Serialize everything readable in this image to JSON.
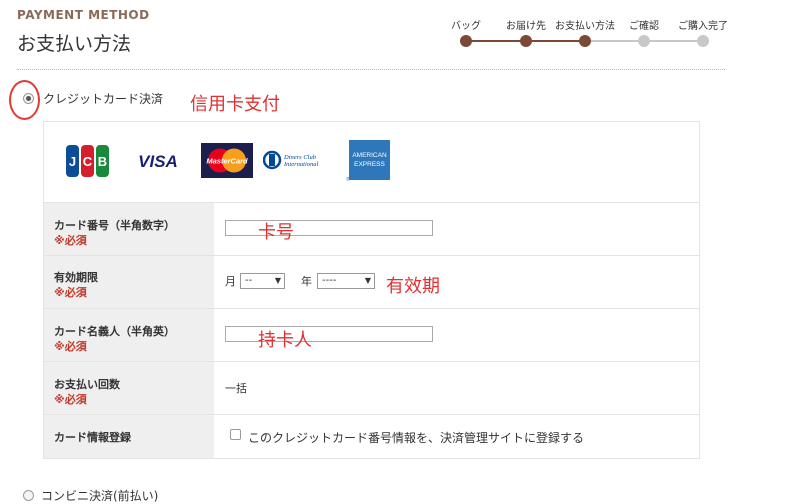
{
  "header": {
    "section_label": "PAYMENT METHOD",
    "title": "お支払い方法"
  },
  "steps": {
    "items": [
      {
        "label": "バッグ",
        "state": "done"
      },
      {
        "label": "お届け先",
        "state": "done"
      },
      {
        "label": "お支払い方法",
        "state": "current"
      },
      {
        "label": "ご確認",
        "state": "todo"
      },
      {
        "label": "ご購入完了",
        "state": "todo"
      }
    ],
    "colors": {
      "done": "#7a4a36",
      "todo": "#c8c8c8"
    }
  },
  "credit": {
    "option_label": "クレジットカード決済",
    "selected": true,
    "annotation": "信用卡支付"
  },
  "logos": [
    {
      "name": "jcb-logo",
      "text": "JCB"
    },
    {
      "name": "visa-logo",
      "text": "VISA"
    },
    {
      "name": "mastercard-logo",
      "text": "MasterCard"
    },
    {
      "name": "diners-logo",
      "text": "Diners Club International"
    },
    {
      "name": "amex-logo",
      "text": "AMERICAN EXPRESS"
    }
  ],
  "form": {
    "card_number": {
      "label": "カード番号（半角数字）",
      "required": "※必須",
      "value": "",
      "annotation": "卡号"
    },
    "expiry": {
      "label": "有効期限",
      "required": "※必須",
      "month_label": "月",
      "month_value": "--",
      "year_label": "年",
      "year_value": "----",
      "annotation": "有效期"
    },
    "card_holder": {
      "label": "カード名義人（半角英）",
      "required": "※必須",
      "value": "",
      "annotation": "持卡人"
    },
    "installments": {
      "label": "お支払い回数",
      "required": "※必須",
      "value": "一括"
    },
    "register": {
      "label": "カード情報登録",
      "checkbox_label": "このクレジットカード番号情報を、決済管理サイトに登録する",
      "checked": false
    }
  },
  "convenience": {
    "option_label": "コンビニ決済(前払い)",
    "selected": false
  }
}
